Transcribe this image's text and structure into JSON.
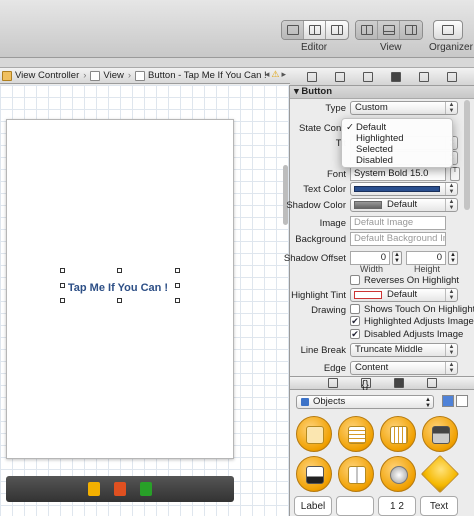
{
  "toolbar": {
    "editor_label": "Editor",
    "view_label": "View",
    "organizer_label": "Organizer"
  },
  "breadcrumb": {
    "items": [
      "View Controller",
      "View",
      "Button - Tap Me If You Can !"
    ],
    "separator": "›",
    "warning_icon": "warning-icon"
  },
  "canvas": {
    "button_title": "Tap Me If You Can !",
    "title_color": "#2d4f86"
  },
  "inspector": {
    "section_title": "Button",
    "type_label": "Type",
    "type_value": "Custom",
    "state_config_label": "State Confi",
    "title_label": "Tit",
    "font_label": "Font",
    "font_value": "System Bold 15.0",
    "text_color_label": "Text Color",
    "text_color_value": "#2a4f8f",
    "shadow_color_label": "Shadow Color",
    "shadow_color_value": "Default",
    "image_label": "Image",
    "image_placeholder": "Default Image",
    "background_label": "Background",
    "background_placeholder": "Default Background Image",
    "shadow_offset_label": "Shadow Offset",
    "shadow_offset_width": "0",
    "shadow_offset_height": "0",
    "width_label": "Width",
    "height_label": "Height",
    "reverses_label": "Reverses On Highlight",
    "reverses_checked": false,
    "highlight_tint_label": "Highlight Tint",
    "highlight_tint_value": "Default",
    "drawing_label": "Drawing",
    "shows_touch_label": "Shows Touch On Highlight",
    "shows_touch_checked": false,
    "highlighted_adjusts_label": "Highlighted Adjusts Image",
    "highlighted_adjusts_checked": true,
    "disabled_adjusts_label": "Disabled Adjusts Image",
    "disabled_adjusts_checked": true,
    "line_break_label": "Line Break",
    "line_break_value": "Truncate Middle",
    "edge_label": "Edge",
    "edge_value": "Content"
  },
  "state_menu": {
    "items": [
      "Default",
      "Highlighted",
      "Selected",
      "Disabled"
    ],
    "checkmark": "✓",
    "selected_index": 0
  },
  "library": {
    "filter_value": "Objects",
    "tiles": [
      "Label",
      "",
      "1 2",
      "Text"
    ]
  }
}
